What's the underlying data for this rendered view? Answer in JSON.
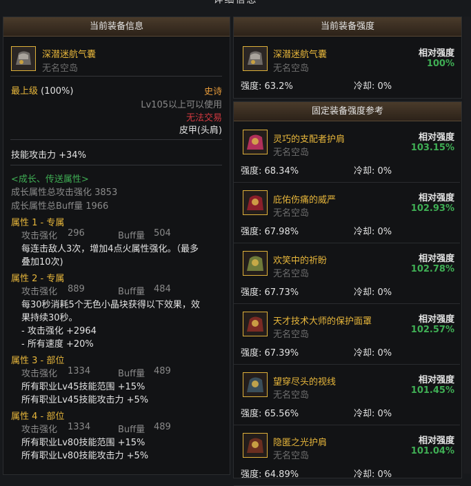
{
  "top": {
    "title": "详细信息"
  },
  "left": {
    "header": "当前装备信息",
    "item": {
      "name": "深潜迷航气囊",
      "source": "无名空岛"
    },
    "grade_label": "最上级",
    "grade_pct": "(100%)",
    "rarity": "史诗",
    "level_req": "Lv105以上可以使用",
    "trade": "无法交易",
    "slot": "皮甲(头肩)",
    "skill_atk": "技能攻击力 +34%",
    "growth_title": "<成长、传送属性>",
    "growth_atk": "成长属性总攻击强化 3853",
    "growth_buff": "成长属性总Buff量 1966",
    "attrs": [
      {
        "title": "属性 1 - 专属",
        "atk_label": "攻击强化",
        "atk_val": "296",
        "buff_label": "Buff量",
        "buff_val": "504",
        "desc": [
          "每连击敌人3次，增加4点火属性强化。（最多",
          "叠加10次)"
        ]
      },
      {
        "title": "属性 2 - 专属",
        "atk_label": "攻击强化",
        "atk_val": "889",
        "buff_label": "Buff量",
        "buff_val": "484",
        "desc": [
          "每30秒消耗5个无色小晶块获得以下效果，效",
          "果持续30秒。",
          "- 攻击强化 +2964",
          "- 所有速度 +20%"
        ]
      },
      {
        "title": "属性 3 - 部位",
        "atk_label": "攻击强化",
        "atk_val": "1334",
        "buff_label": "Buff量",
        "buff_val": "489",
        "desc": [
          "所有职业Lv45技能范围 +15%",
          "所有职业Lv45技能攻击力 +5%"
        ]
      },
      {
        "title": "属性 4 - 部位",
        "atk_label": "攻击强化",
        "atk_val": "1334",
        "buff_label": "Buff量",
        "buff_val": "489",
        "desc": [
          "所有职业Lv80技能范围 +15%",
          "所有职业Lv80技能攻击力 +5%"
        ]
      }
    ]
  },
  "right": {
    "header": "当前装备强度",
    "current": {
      "name": "深潜迷航气囊",
      "source": "无名空岛",
      "rel_label": "相对强度",
      "rel_val": "100%",
      "strength": "强度: 63.2%",
      "cooldown": "冷却: 0%"
    },
    "ref_header": "固定装备强度参考",
    "refs": [
      {
        "name": "灵巧的支配者护肩",
        "source": "无名空岛",
        "rel_label": "相对强度",
        "rel_val": "103.15%",
        "strength": "强度: 68.34%",
        "cooldown": "冷却: 0%",
        "icon": "shoulder-orb-icon",
        "color": "#b0305a"
      },
      {
        "name": "庇佑伤痛的威严",
        "source": "无名空岛",
        "rel_label": "相对强度",
        "rel_val": "102.93%",
        "strength": "强度: 67.98%",
        "cooldown": "冷却: 0%",
        "icon": "cape-icon",
        "color": "#8a1f2a"
      },
      {
        "name": "欢笑中的祈盼",
        "source": "无名空岛",
        "rel_label": "相对强度",
        "rel_val": "102.78%",
        "strength": "强度: 67.73%",
        "cooldown": "冷却: 0%",
        "icon": "armor-icon",
        "color": "#6f7a3a"
      },
      {
        "name": "天才技术大师的保护面罩",
        "source": "无名空岛",
        "rel_label": "相对强度",
        "rel_val": "102.57%",
        "strength": "强度: 67.39%",
        "cooldown": "冷却: 0%",
        "icon": "mask-icon",
        "color": "#7a2a24"
      },
      {
        "name": "望穿尽头的视线",
        "source": "无名空岛",
        "rel_label": "相对强度",
        "rel_val": "101.45%",
        "strength": "强度: 65.56%",
        "cooldown": "冷却: 0%",
        "icon": "helmet-icon",
        "color": "#3a4e5a"
      },
      {
        "name": "隐匿之光护肩",
        "source": "无名空岛",
        "rel_label": "相对强度",
        "rel_val": "101.04%",
        "strength": "强度: 64.89%",
        "cooldown": "冷却: 0%",
        "icon": "pauldron-icon",
        "color": "#6a2e20"
      }
    ]
  }
}
